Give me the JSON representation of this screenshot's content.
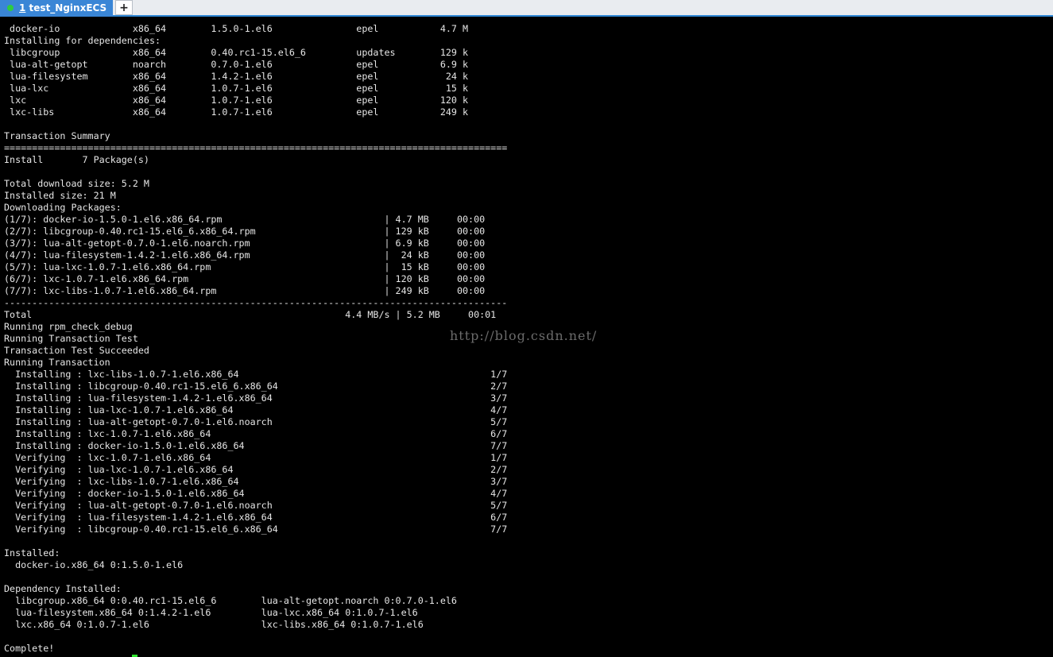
{
  "tab": {
    "number": "1",
    "title": "test_NginxECS",
    "status_color": "#2ecc40"
  },
  "new_tab_label": "+",
  "terminal": {
    "lines": [
      " docker-io             x86_64        1.5.0-1.el6               epel           4.7 M",
      "Installing for dependencies:",
      " libcgroup             x86_64        0.40.rc1-15.el6_6         updates        129 k",
      " lua-alt-getopt        noarch        0.7.0-1.el6               epel           6.9 k",
      " lua-filesystem        x86_64        1.4.2-1.el6               epel            24 k",
      " lua-lxc               x86_64        1.0.7-1.el6               epel            15 k",
      " lxc                   x86_64        1.0.7-1.el6               epel           120 k",
      " lxc-libs              x86_64        1.0.7-1.el6               epel           249 k",
      "",
      "Transaction Summary",
      "==========================================================================================",
      "Install       7 Package(s)",
      "",
      "Total download size: 5.2 M",
      "Installed size: 21 M",
      "Downloading Packages:",
      "(1/7): docker-io-1.5.0-1.el6.x86_64.rpm                             | 4.7 MB     00:00",
      "(2/7): libcgroup-0.40.rc1-15.el6_6.x86_64.rpm                       | 129 kB     00:00",
      "(3/7): lua-alt-getopt-0.7.0-1.el6.noarch.rpm                        | 6.9 kB     00:00",
      "(4/7): lua-filesystem-1.4.2-1.el6.x86_64.rpm                        |  24 kB     00:00",
      "(5/7): lua-lxc-1.0.7-1.el6.x86_64.rpm                               |  15 kB     00:00",
      "(6/7): lxc-1.0.7-1.el6.x86_64.rpm                                   | 120 kB     00:00",
      "(7/7): lxc-libs-1.0.7-1.el6.x86_64.rpm                              | 249 kB     00:00",
      "------------------------------------------------------------------------------------------",
      "Total                                                        4.4 MB/s | 5.2 MB     00:01",
      "Running rpm_check_debug",
      "Running Transaction Test",
      "Transaction Test Succeeded",
      "Running Transaction",
      "  Installing : lxc-libs-1.0.7-1.el6.x86_64                                             1/7",
      "  Installing : libcgroup-0.40.rc1-15.el6_6.x86_64                                      2/7",
      "  Installing : lua-filesystem-1.4.2-1.el6.x86_64                                       3/7",
      "  Installing : lua-lxc-1.0.7-1.el6.x86_64                                              4/7",
      "  Installing : lua-alt-getopt-0.7.0-1.el6.noarch                                       5/7",
      "  Installing : lxc-1.0.7-1.el6.x86_64                                                  6/7",
      "  Installing : docker-io-1.5.0-1.el6.x86_64                                            7/7",
      "  Verifying  : lxc-1.0.7-1.el6.x86_64                                                  1/7",
      "  Verifying  : lua-lxc-1.0.7-1.el6.x86_64                                              2/7",
      "  Verifying  : lxc-libs-1.0.7-1.el6.x86_64                                             3/7",
      "  Verifying  : docker-io-1.5.0-1.el6.x86_64                                            4/7",
      "  Verifying  : lua-alt-getopt-0.7.0-1.el6.noarch                                       5/7",
      "  Verifying  : lua-filesystem-1.4.2-1.el6.x86_64                                       6/7",
      "  Verifying  : libcgroup-0.40.rc1-15.el6_6.x86_64                                      7/7",
      "",
      "Installed:",
      "  docker-io.x86_64 0:1.5.0-1.el6",
      "",
      "Dependency Installed:",
      "  libcgroup.x86_64 0:0.40.rc1-15.el6_6        lua-alt-getopt.noarch 0:0.7.0-1.el6",
      "  lua-filesystem.x86_64 0:1.4.2-1.el6         lua-lxc.x86_64 0:1.0.7-1.el6",
      "  lxc.x86_64 0:1.0.7-1.el6                    lxc-libs.x86_64 0:1.0.7-1.el6",
      "",
      "Complete!"
    ],
    "cursor_color": "#2ee62e"
  },
  "watermark": "http://blog.csdn.net/"
}
